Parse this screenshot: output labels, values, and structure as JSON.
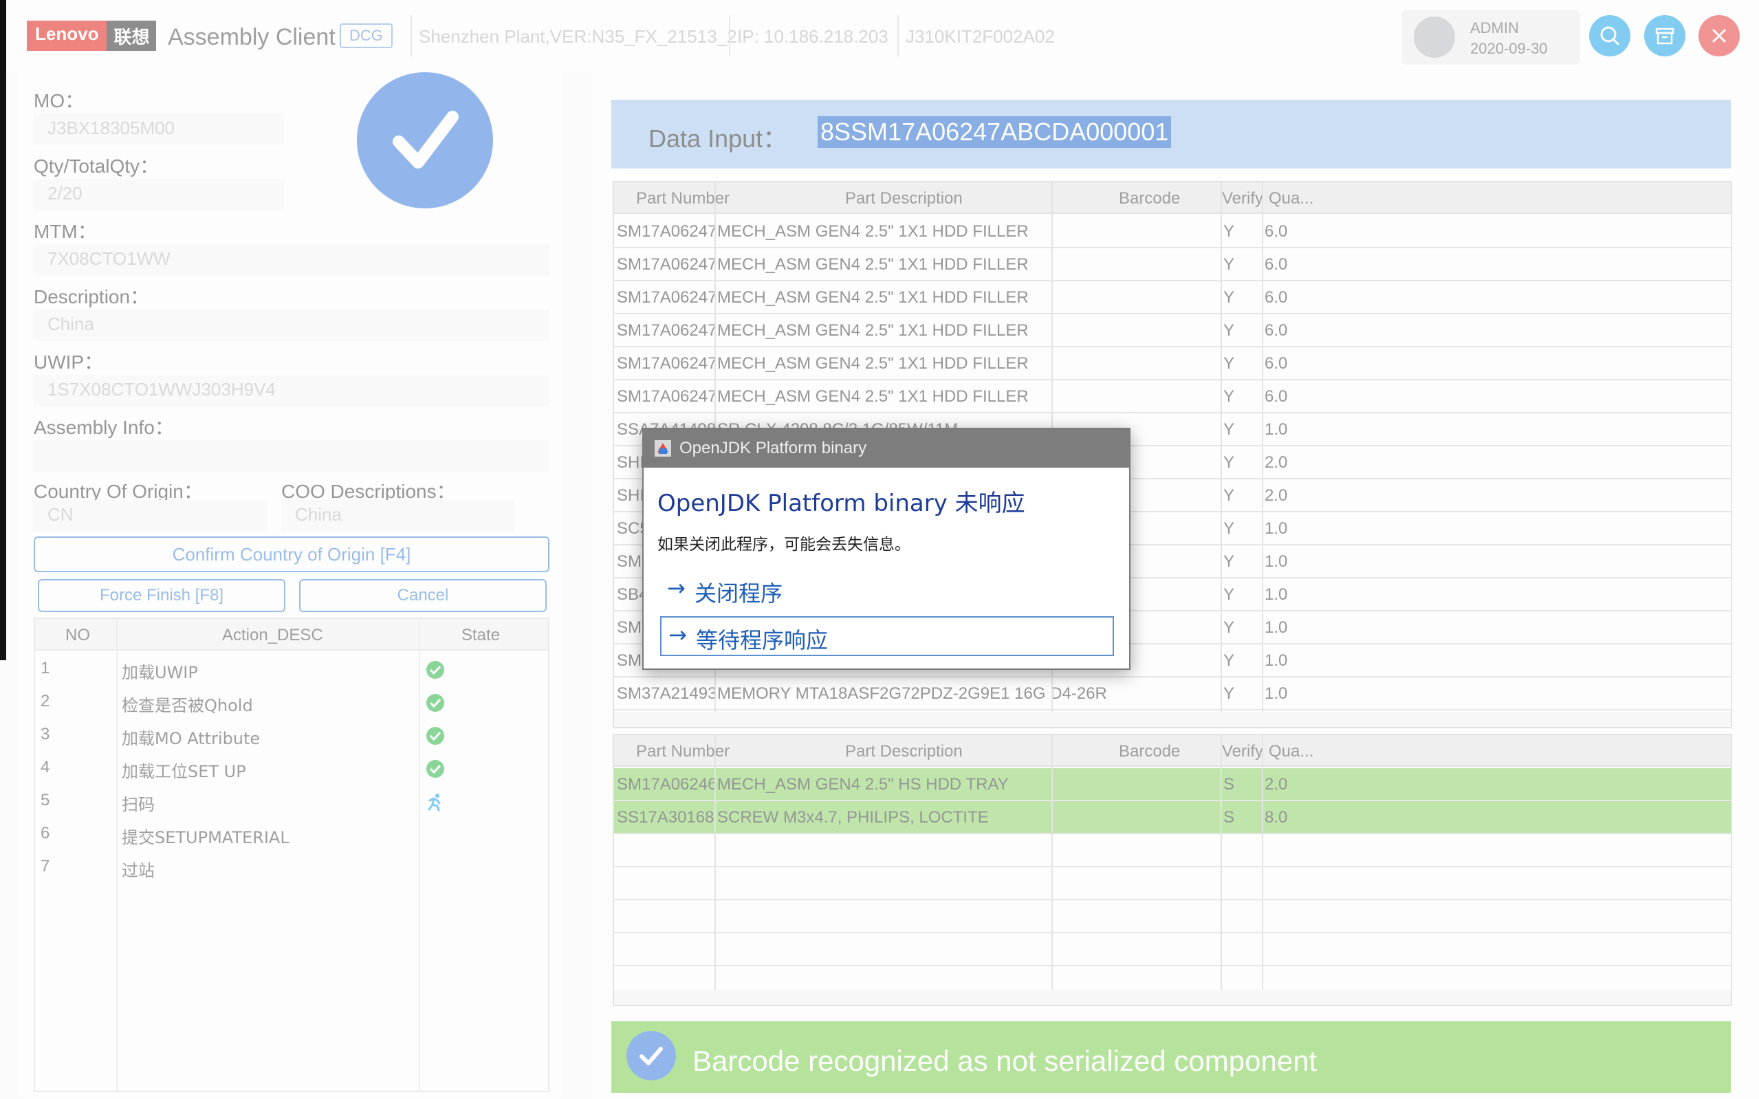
{
  "header": {
    "logo_en": "Lenovo",
    "logo_cn": "联想",
    "app_title": "Assembly Client",
    "dcg_badge": "DCG",
    "plant_version": "Shenzhen Plant,VER:N35_FX_21513_2",
    "ip": "IP: 10.186.218.203",
    "station": "J310KIT2F002A02",
    "user_name": "ADMIN",
    "user_date": "2020-09-30"
  },
  "left": {
    "mo_label": "MO：",
    "mo_value": "J3BX18305M00",
    "qty_label": "Qty/TotalQty：",
    "qty_value": "2/20",
    "mtm_label": "MTM：",
    "mtm_value": "7X08CTO1WW",
    "desc_label": "Description：",
    "desc_value": "China",
    "uwip_label": "UWIP：",
    "uwip_value": "1S7X08CTO1WWJ303H9V4",
    "assembly_label": "Assembly Info：",
    "assembly_value": "",
    "coo_label": "Country Of Origin：",
    "coo_value": "CN",
    "coo_desc_label": "COO Descriptions：",
    "coo_desc_value": "China",
    "confirm_btn": "Confirm Country of Origin [F4]",
    "force_btn": "Force Finish [F8]",
    "cancel_btn": "Cancel",
    "action_headers": [
      "NO",
      "Action_DESC",
      "State"
    ],
    "actions": [
      {
        "no": "1",
        "desc": "加载UWIP",
        "state": "done"
      },
      {
        "no": "2",
        "desc": "检查是否被Qhold",
        "state": "done"
      },
      {
        "no": "3",
        "desc": "加载MO Attribute",
        "state": "done"
      },
      {
        "no": "4",
        "desc": "加载工位SET UP",
        "state": "done"
      },
      {
        "no": "5",
        "desc": "扫码",
        "state": "running"
      },
      {
        "no": "6",
        "desc": "提交SETUPMATERIAL",
        "state": ""
      },
      {
        "no": "7",
        "desc": "过站",
        "state": ""
      }
    ]
  },
  "right": {
    "data_input_label": "Data Input：",
    "data_input_value": "8SSM17A06247ABCDA000001",
    "grid_headers": [
      "Part Number",
      "Part Description",
      "Barcode",
      "Verify",
      "Qua..."
    ],
    "grid1_rows": [
      [
        "SM17A06247",
        "MECH_ASM GEN4 2.5\" 1X1 HDD FILLER",
        "",
        "Y",
        "6.0"
      ],
      [
        "SM17A06247",
        "MECH_ASM GEN4 2.5\" 1X1 HDD FILLER",
        "",
        "Y",
        "6.0"
      ],
      [
        "SM17A06247",
        "MECH_ASM GEN4 2.5\" 1X1 HDD FILLER",
        "",
        "Y",
        "6.0"
      ],
      [
        "SM17A06247",
        "MECH_ASM GEN4 2.5\" 1X1 HDD FILLER",
        "",
        "Y",
        "6.0"
      ],
      [
        "SM17A06247",
        "MECH_ASM GEN4 2.5\" 1X1 HDD FILLER",
        "",
        "Y",
        "6.0"
      ],
      [
        "SM17A06247",
        "MECH_ASM GEN4 2.5\" 1X1 HDD FILLER",
        "",
        "Y",
        "6.0"
      ],
      [
        "SSA7A41408",
        "SR CLX 4208 8C/2.1G/85W/11M",
        "",
        "Y",
        "1.0"
      ],
      [
        "SHI",
        "",
        "",
        "Y",
        "2.0"
      ],
      [
        "SHI",
        "",
        "",
        "Y",
        "2.0"
      ],
      [
        "SC5",
        "",
        "",
        "Y",
        "1.0"
      ],
      [
        "SM1",
        "",
        "",
        "Y",
        "1.0"
      ],
      [
        "SB4",
        "",
        "",
        "Y",
        "1.0"
      ],
      [
        "SM1",
        "",
        "",
        "Y",
        "1.0"
      ],
      [
        "SM1",
        "",
        "",
        "Y",
        "1.0"
      ],
      [
        "SM37A21493",
        "MEMORY MTA18ASF2G72PDZ-2G9E1 16G D4-26R",
        "",
        "Y",
        "1.0"
      ]
    ],
    "grid2_rows": [
      [
        "SM17A06246",
        "MECH_ASM GEN4 2.5\" HS HDD TRAY",
        "",
        "S",
        "2.0"
      ],
      [
        "SS17A30168",
        "SCREW M3x4.7, PHILIPS, LOCTITE",
        "",
        "S",
        "8.0"
      ],
      [
        "",
        "",
        "",
        "",
        ""
      ],
      [
        "",
        "",
        "",
        "",
        ""
      ],
      [
        "",
        "",
        "",
        "",
        ""
      ],
      [
        "",
        "",
        "",
        "",
        ""
      ],
      [
        "",
        "",
        "",
        "",
        ""
      ]
    ],
    "status_message": "Barcode recognized as not serialized component"
  },
  "dialog": {
    "title": "OpenJDK Platform binary",
    "heading": "OpenJDK Platform binary 未响应",
    "message": "如果关闭此程序，可能会丢失信息。",
    "option_close": "关闭程序",
    "option_wait": "等待程序响应",
    "arrow": "→"
  },
  "colors": {
    "accent_blue": "#3c7fe0",
    "success_green": "#7fd04f",
    "danger_red": "#e2231a"
  }
}
